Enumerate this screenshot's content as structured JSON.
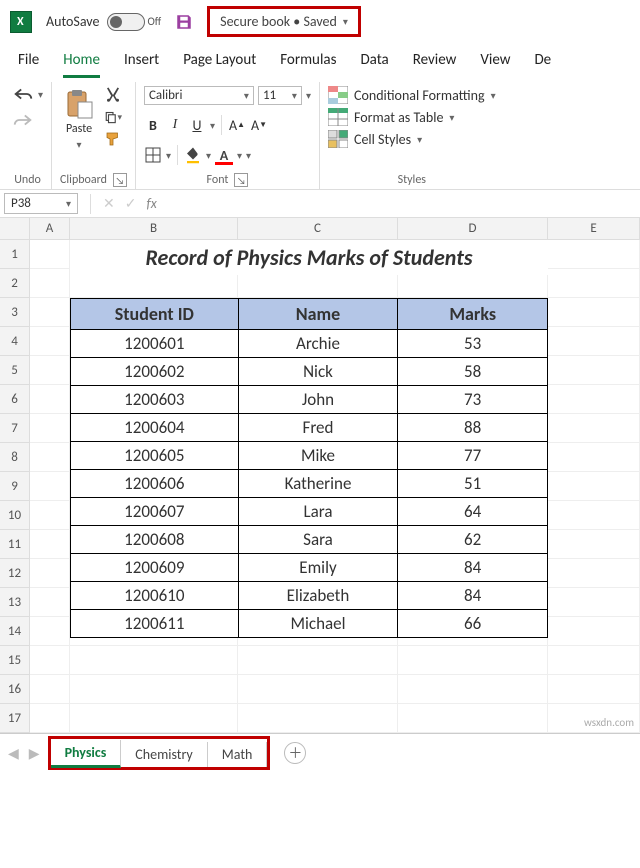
{
  "titlebar": {
    "autosave_label": "AutoSave",
    "autosave_state": "Off",
    "doc_title": "Secure book • Saved"
  },
  "menu": {
    "items": [
      "File",
      "Home",
      "Insert",
      "Page Layout",
      "Formulas",
      "Data",
      "Review",
      "View",
      "De"
    ],
    "active_index": 1
  },
  "ribbon": {
    "undo_label": "Undo",
    "clipboard_label": "Clipboard",
    "paste_label": "Paste",
    "font_label": "Font",
    "styles_label": "Styles",
    "font_name": "Calibri",
    "font_size": "11",
    "cond_fmt": "Conditional Formatting",
    "fmt_table": "Format as Table",
    "cell_styles": "Cell Styles"
  },
  "formula": {
    "namebox": "P38",
    "fx_label": "fx",
    "value": ""
  },
  "columns": [
    "A",
    "B",
    "C",
    "D",
    "E"
  ],
  "rows": [
    "1",
    "2",
    "3",
    "4",
    "5",
    "6",
    "7",
    "8",
    "9",
    "10",
    "11",
    "12",
    "13",
    "14",
    "15",
    "16",
    "17"
  ],
  "sheet_title": "Record of Physics Marks of Students",
  "table": {
    "headers": [
      "Student ID",
      "Name",
      "Marks"
    ],
    "data": [
      [
        "1200601",
        "Archie",
        "53"
      ],
      [
        "1200602",
        "Nick",
        "58"
      ],
      [
        "1200603",
        "John",
        "73"
      ],
      [
        "1200604",
        "Fred",
        "88"
      ],
      [
        "1200605",
        "Mike",
        "77"
      ],
      [
        "1200606",
        "Katherine",
        "51"
      ],
      [
        "1200607",
        "Lara",
        "64"
      ],
      [
        "1200608",
        "Sara",
        "62"
      ],
      [
        "1200609",
        "Emily",
        "84"
      ],
      [
        "1200610",
        "Elizabeth",
        "84"
      ],
      [
        "1200611",
        "Michael",
        "66"
      ]
    ]
  },
  "sheet_tabs": {
    "items": [
      "Physics",
      "Chemistry",
      "Math"
    ],
    "active_index": 0
  },
  "watermark": "wsxdn.com"
}
